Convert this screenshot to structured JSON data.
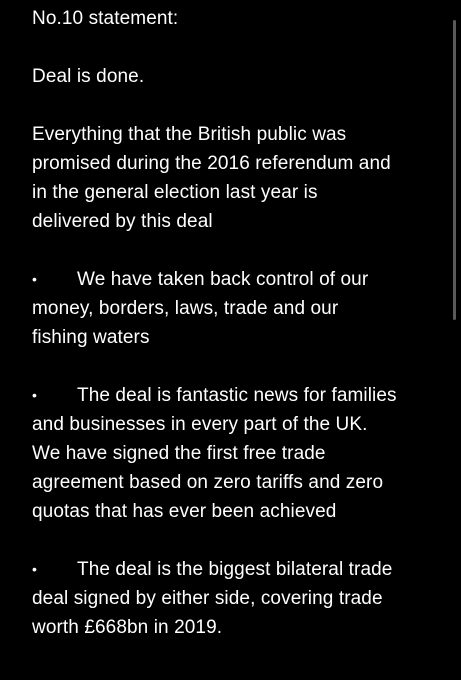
{
  "note": {
    "heading": "No.10 statement:",
    "p1": "Deal is done.",
    "p2_lines": [
      "Everything that the British public was",
      "promised during the 2016 referendum and",
      "in the general election last year is",
      "delivered by this deal"
    ],
    "bullet_glyph": "•",
    "bullet1": {
      "first": "We have taken back control of our",
      "rest": [
        "money, borders, laws, trade and our",
        "fishing waters"
      ]
    },
    "bullet2": {
      "first": "The deal is fantastic news for families",
      "rest": [
        "and businesses in every part of the UK.",
        "We have signed the first free trade",
        "agreement based on zero tariffs and zero",
        "quotas that has ever been achieved"
      ]
    },
    "bullet3": {
      "first": "The deal is the biggest bilateral trade",
      "rest": [
        "deal signed by either side, covering trade",
        "worth £668bn in 2019."
      ]
    }
  }
}
